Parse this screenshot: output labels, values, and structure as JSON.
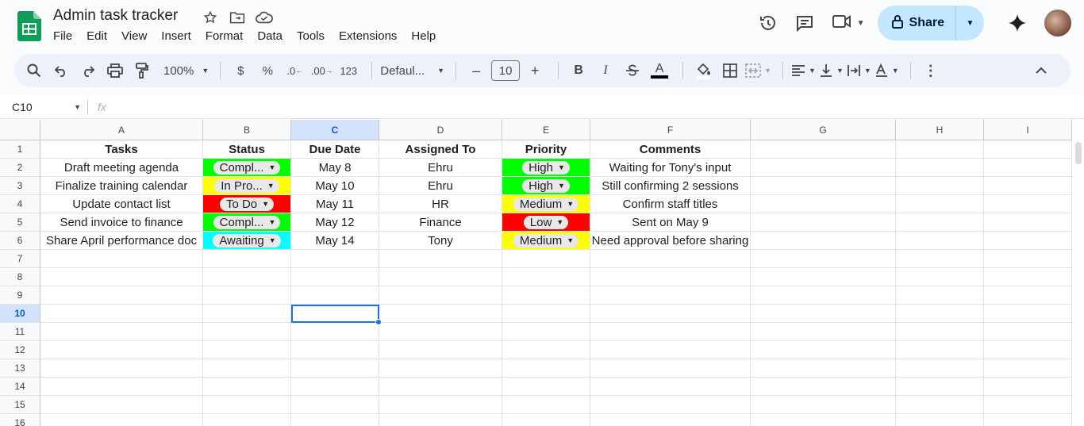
{
  "title": "Admin task tracker",
  "menu": [
    "File",
    "Edit",
    "View",
    "Insert",
    "Format",
    "Data",
    "Tools",
    "Extensions",
    "Help"
  ],
  "share_label": "Share",
  "toolbar": {
    "zoom": "100%",
    "currency": "$",
    "percent": "%",
    "dec_decrease": ".0",
    "dec_increase": ".00",
    "format_123": "123",
    "font": "Defaul...",
    "font_size": "10",
    "minus": "–",
    "plus": "+",
    "bold": "B",
    "italic": "I",
    "underline_color": "A",
    "more": "⋮"
  },
  "namebox": "C10",
  "fx": "fx",
  "columns": [
    "A",
    "B",
    "C",
    "D",
    "E",
    "F",
    "G",
    "H",
    "I"
  ],
  "selected_column": "C",
  "selected_row": "10",
  "headers": {
    "tasks": "Tasks",
    "status": "Status",
    "due": "Due Date",
    "assigned": "Assigned To",
    "priority": "Priority",
    "comments": "Comments"
  },
  "rows": [
    {
      "task": "Draft meeting agenda",
      "status": "Compl...",
      "status_color": "#00ff00",
      "due": "May 8",
      "assigned": "Ehru",
      "priority": "High",
      "priority_color": "#00ff00",
      "comment": "Waiting for Tony's input"
    },
    {
      "task": "Finalize training calendar",
      "status": "In Pro...",
      "status_color": "#ffff00",
      "due": "May 10",
      "assigned": "Ehru",
      "priority": "High",
      "priority_color": "#00ff00",
      "comment": "Still confirming 2 sessions"
    },
    {
      "task": "Update contact list",
      "status": "To Do",
      "status_color": "#ff0000",
      "due": "May 11",
      "assigned": "HR",
      "priority": "Medium",
      "priority_color": "#ffff00",
      "comment": "Confirm staff titles"
    },
    {
      "task": "Send invoice to finance",
      "status": "Compl...",
      "status_color": "#00ff00",
      "due": "May 12",
      "assigned": "Finance",
      "priority": "Low",
      "priority_color": "#ff0000",
      "comment": "Sent on May 9"
    },
    {
      "task": "Share April performance doc",
      "status": "Awaiting",
      "status_color": "#00ffff",
      "due": "May 14",
      "assigned": "Tony",
      "priority": "Medium",
      "priority_color": "#ffff00",
      "comment": "Need approval before sharing"
    }
  ],
  "row_numbers": [
    "1",
    "2",
    "3",
    "4",
    "5",
    "6",
    "7",
    "8",
    "9",
    "10",
    "11",
    "12",
    "13",
    "14",
    "15",
    "16"
  ]
}
